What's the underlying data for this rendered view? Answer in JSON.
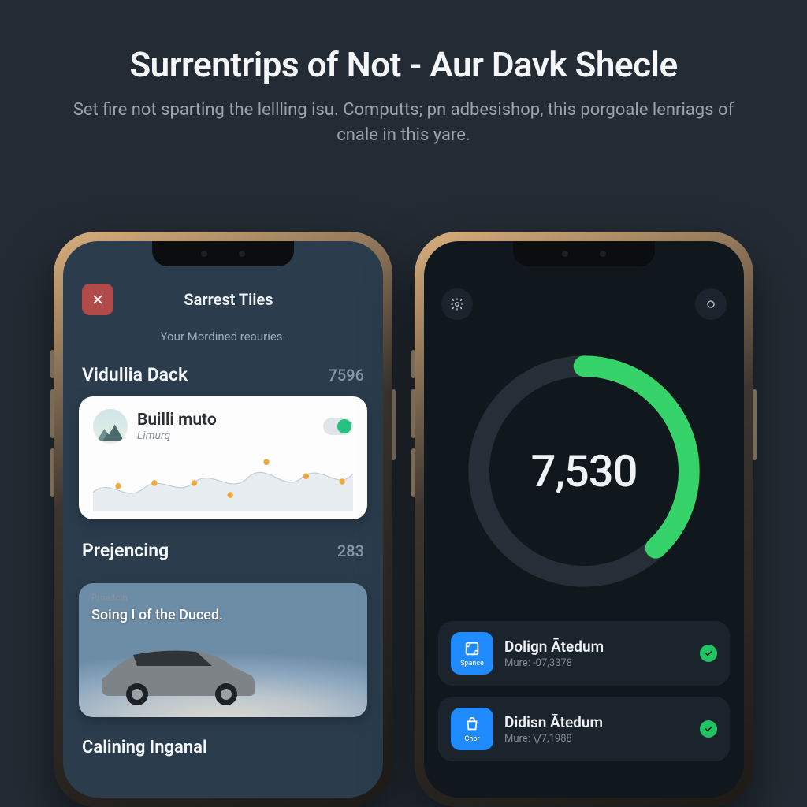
{
  "hero": {
    "title": "Surrentrips of Not - Aur Davk Shecle",
    "subtitle": "Set fire not sparting the lellling isu. Computts; pn adbesishop, this porgoale lenriags of cnale in this yare."
  },
  "phoneLeft": {
    "header": {
      "title": "Sarrest Tiies"
    },
    "subheader": "Your Mordined reauries.",
    "section1": {
      "name": "Vidullia Dack",
      "value": "7596"
    },
    "card": {
      "title": "Builli muto",
      "subtitle": "Limurg"
    },
    "section2": {
      "name": "Prejencing",
      "value": "283"
    },
    "imageCard": {
      "tag": "Proadcin",
      "caption": "Soing I of the Duced."
    },
    "section3": {
      "name": "Calining Inganal"
    }
  },
  "phoneRight": {
    "gauge": {
      "value": "7,530",
      "percent": 38
    },
    "rows": [
      {
        "iconLabel": "Spance",
        "title": "Dolign Ātedum",
        "subtitle": "Mure: -07,3378"
      },
      {
        "iconLabel": "Chor",
        "title": "Didisn Ātedum",
        "subtitle": "Mure: ⋁7,1988"
      }
    ]
  }
}
